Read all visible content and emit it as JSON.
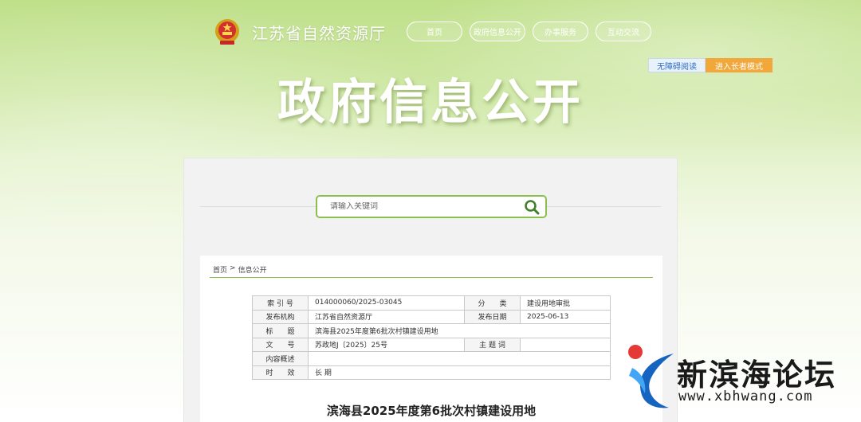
{
  "header": {
    "site_title": "江苏省自然资源厅",
    "nav": [
      "首页",
      "政府信息公开",
      "办事服务",
      "互动交流"
    ]
  },
  "modes": {
    "accessible": "无障碍阅读",
    "elder": "进入长者模式"
  },
  "banner": {
    "title": "政府信息公开"
  },
  "search": {
    "placeholder": "请输入关键词"
  },
  "breadcrumb": {
    "home": "首页",
    "sep": ">",
    "current": "信息公开"
  },
  "meta_table": {
    "index_label": "索 引 号",
    "index_value": "014000060/2025-03045",
    "category_label": "分　　类",
    "category_value": "建设用地审批",
    "issuer_label": "发布机构",
    "issuer_value": "江苏省自然资源厅",
    "date_label": "发布日期",
    "date_value": "2025-06-13",
    "title_label": "标　　题",
    "title_value": "滨海县2025年度第6批次村镇建设用地",
    "docno_label": "文　　号",
    "docno_value": "苏政地J〔2025〕25号",
    "subject_label": "主 题 词",
    "subject_value": "",
    "summary_label": "内容概述",
    "summary_value": "",
    "validity_label": "时　　效",
    "validity_value": "长 期"
  },
  "document": {
    "title": "滨海县2025年度第6批次村镇建设用地"
  },
  "watermark": {
    "text": "新滨海论坛",
    "url": "www.xbhwang.com"
  },
  "colors": {
    "accent_green": "#8bbf4f",
    "elder_orange": "#f2a73b",
    "accessible_blue": "#2d6fc0"
  },
  "icons": {
    "emblem": "national-emblem-icon",
    "search": "search-icon",
    "logo": "forum-logo-icon"
  }
}
